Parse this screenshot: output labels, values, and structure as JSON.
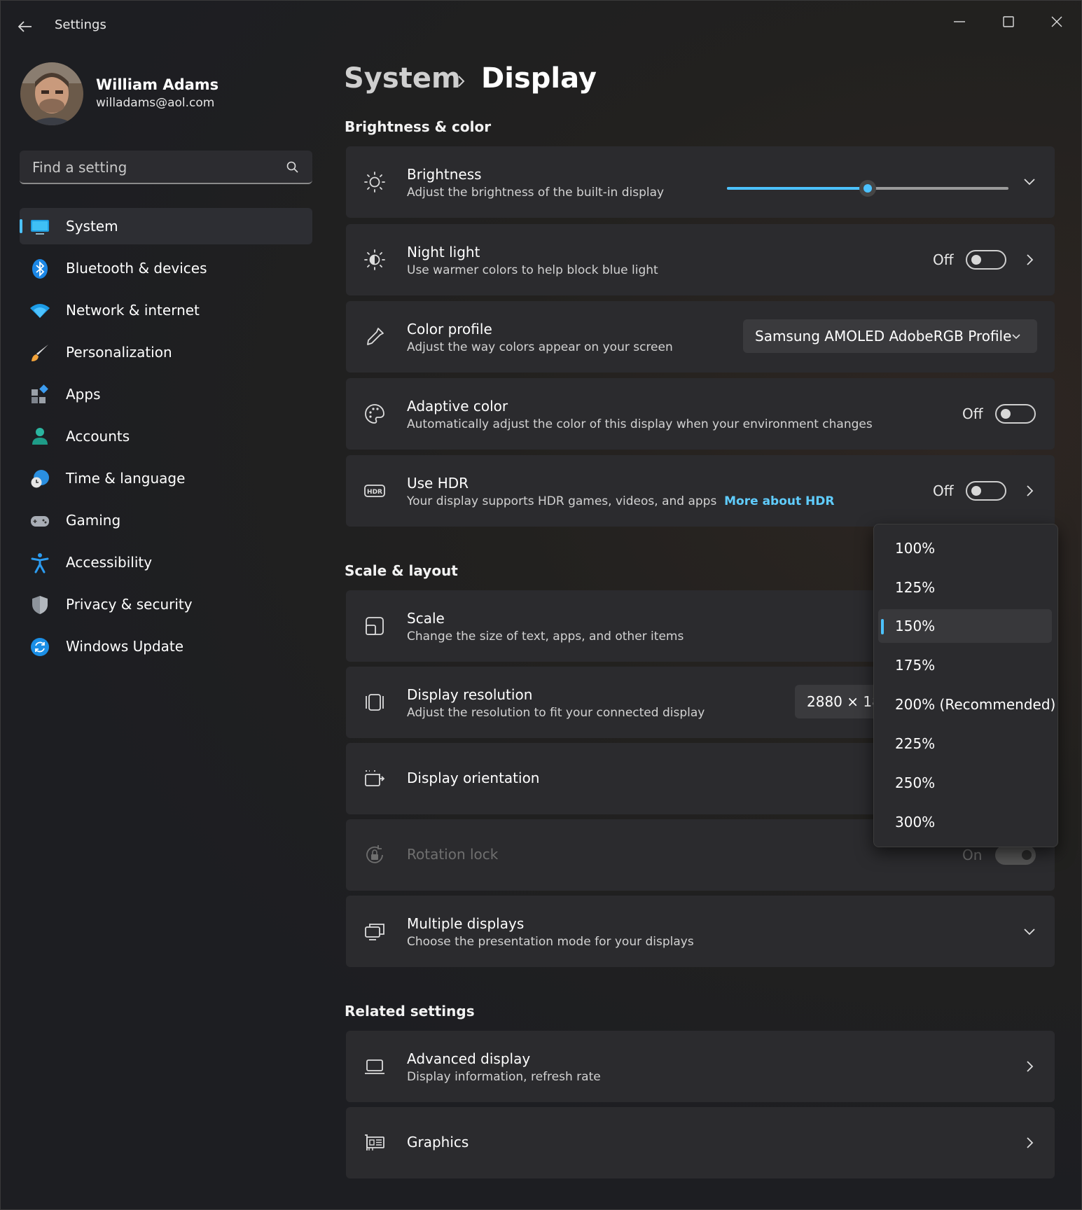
{
  "window": {
    "title": "Settings"
  },
  "user": {
    "name": "William Adams",
    "email": "willadams@aol.com"
  },
  "search": {
    "placeholder": "Find a setting"
  },
  "nav": [
    {
      "label": "System",
      "icon": "system-icon",
      "active": true
    },
    {
      "label": "Bluetooth & devices",
      "icon": "bluetooth-icon"
    },
    {
      "label": "Network & internet",
      "icon": "wifi-icon"
    },
    {
      "label": "Personalization",
      "icon": "brush-icon"
    },
    {
      "label": "Apps",
      "icon": "apps-icon"
    },
    {
      "label": "Accounts",
      "icon": "accounts-icon"
    },
    {
      "label": "Time & language",
      "icon": "clock-globe-icon"
    },
    {
      "label": "Gaming",
      "icon": "gamepad-icon"
    },
    {
      "label": "Accessibility",
      "icon": "accessibility-icon"
    },
    {
      "label": "Privacy & security",
      "icon": "shield-icon"
    },
    {
      "label": "Windows Update",
      "icon": "update-icon"
    }
  ],
  "breadcrumb": {
    "parent": "System",
    "current": "Display"
  },
  "sections": {
    "brightness_color": "Brightness & color",
    "scale_layout": "Scale & layout",
    "related": "Related settings"
  },
  "cards": {
    "brightness": {
      "title": "Brightness",
      "sub": "Adjust the brightness of the built-in display",
      "value": 0.5
    },
    "night_light": {
      "title": "Night light",
      "sub": "Use warmer colors to help block blue light",
      "state": "Off"
    },
    "color_profile": {
      "title": "Color profile",
      "sub": "Adjust the way colors appear on your screen",
      "value": "Samsung AMOLED AdobeRGB Profile"
    },
    "adaptive_color": {
      "title": "Adaptive color",
      "sub": "Automatically adjust the color of this display when your environment changes",
      "state": "Off"
    },
    "hdr": {
      "title": "Use HDR",
      "sub": "Your display supports HDR games, videos, and apps",
      "link": "More about HDR",
      "state": "Off"
    },
    "scale": {
      "title": "Scale",
      "sub": "Change the size of text, apps, and other items"
    },
    "resolution": {
      "title": "Display resolution",
      "sub": "Adjust the resolution to fit your connected display",
      "value": "2880 × 180"
    },
    "orientation": {
      "title": "Display orientation"
    },
    "rotation_lock": {
      "title": "Rotation lock",
      "state": "On"
    },
    "multiple": {
      "title": "Multiple displays",
      "sub": "Choose the presentation mode for your displays"
    },
    "advanced": {
      "title": "Advanced display",
      "sub": "Display information, refresh rate"
    },
    "graphics": {
      "title": "Graphics"
    }
  },
  "scale_options": [
    "100%",
    "125%",
    "150%",
    "175%",
    "200% (Recommended)",
    "225%",
    "250%",
    "300%"
  ],
  "scale_selected": "150%",
  "colors": {
    "accent": "#4cc2ff",
    "link": "#60cdff",
    "card": "#2b2b2e"
  }
}
